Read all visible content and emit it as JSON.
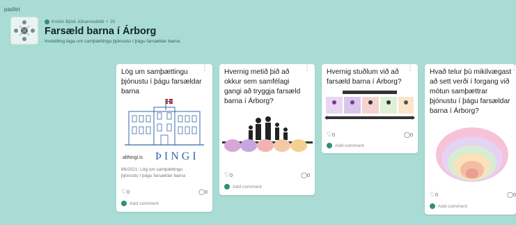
{
  "brand": "padlet",
  "board": {
    "author": "Kristín Björk Jóhannsdóttir",
    "time": "20",
    "title": "Farsæld barna í Árborg",
    "subtitle": "Innleiðing laga um samþættingu þjónustu í þágu farsældar barna"
  },
  "cards": [
    {
      "title": "Lög um samþættingu þjónustu í þágu farsældar barna",
      "link_domain": "althingi.is",
      "building_word": "ÞINGI",
      "caption_line1": "86/2021: Lög um samþættingu",
      "caption_line2": "þjónustu í þágu farsældar barna",
      "likes": "0",
      "comments": "0",
      "add_comment": "Add comment"
    },
    {
      "title": "Hvernig metið þið að okkur sem samfélagi gangi að tryggja farsæld barna í Árborg?",
      "likes": "0",
      "comments": "0",
      "add_comment": "Add comment"
    },
    {
      "title": "Hvernig stuðlum við að farsæld barna í Árborg?",
      "likes": "0",
      "comments": "0",
      "add_comment": "Add comment"
    },
    {
      "title": "Hvað telur þú mikilvægast að sett verði í forgang við mótun samþættrar þjónustu í þágu farsældar barna í Árborg?",
      "likes": "0",
      "comments": "0",
      "add_comment": "Add comment"
    }
  ],
  "colors": {
    "background": "#a9dcd4",
    "accent": "#2f8f7a"
  }
}
